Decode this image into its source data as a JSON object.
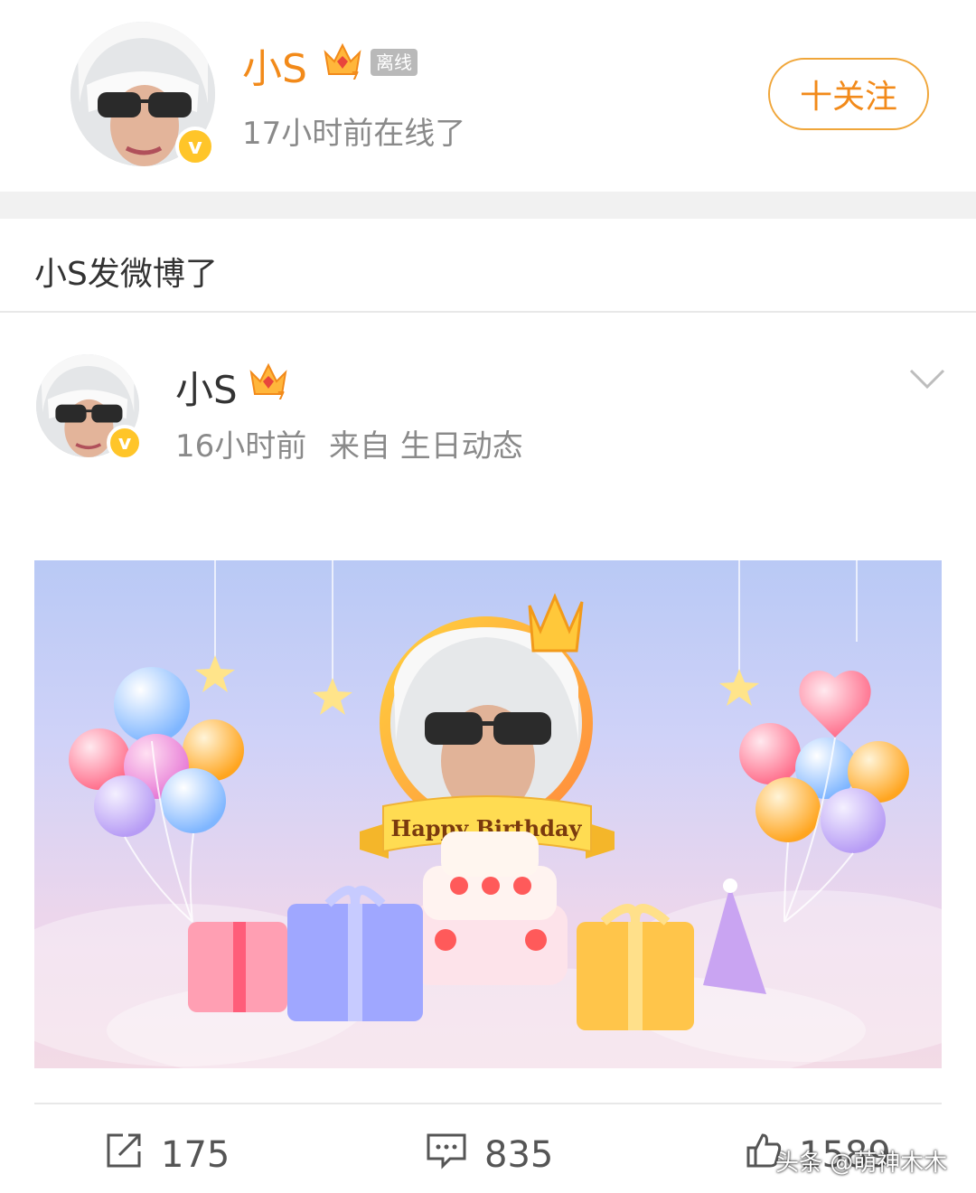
{
  "header": {
    "name": "小S",
    "status_tag": "离线",
    "online_status": "17小时前在线了",
    "follow_label": "十关注",
    "crown_level": "7"
  },
  "section": {
    "title": "小S发微博了"
  },
  "post": {
    "author": "小S",
    "time": "16小时前",
    "source": "来自 生日动态",
    "crown_level": "7",
    "banner_text": "Happy Birthday"
  },
  "actions": {
    "reposts": "175",
    "comments": "835",
    "likes": "1589"
  },
  "watermark": "头条 @萌神木木",
  "colors": {
    "accent": "#f28a1a",
    "verified": "#ffc529"
  }
}
